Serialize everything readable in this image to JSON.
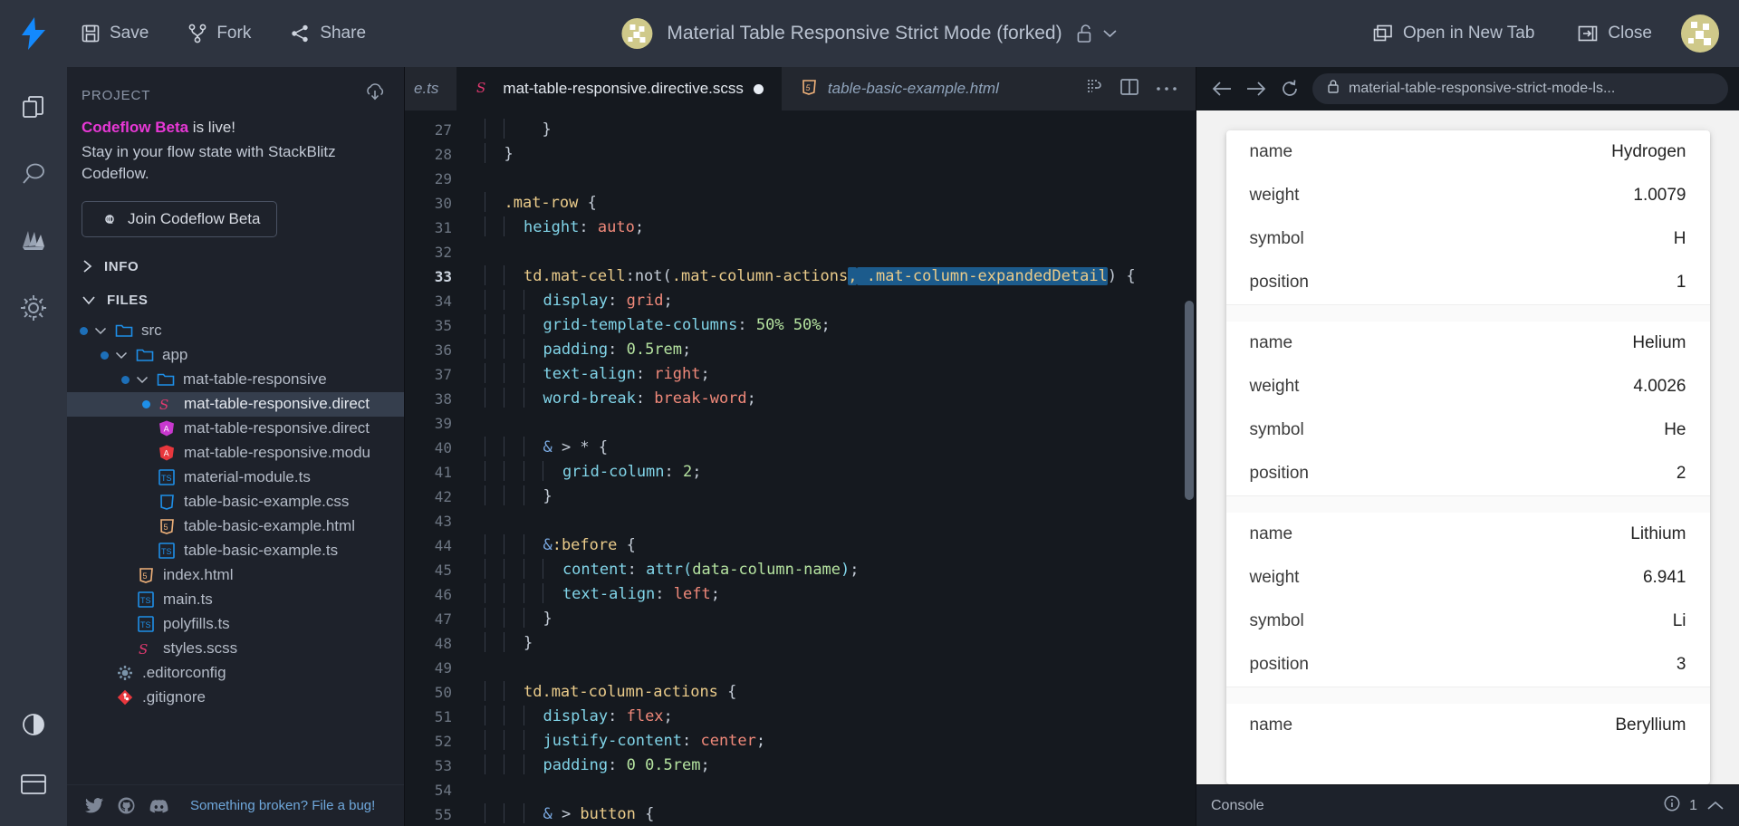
{
  "topbar": {
    "logo": "stackblitz-bolt-icon",
    "save_label": "Save",
    "fork_label": "Fork",
    "share_label": "Share",
    "project_title": "Material Table Responsive Strict Mode (forked)",
    "open_new_tab_label": "Open in New Tab",
    "close_label": "Close"
  },
  "activity_bar": {
    "items": [
      {
        "name": "files-icon"
      },
      {
        "name": "search-icon"
      },
      {
        "name": "deploy-icon"
      },
      {
        "name": "settings-gear-icon"
      }
    ],
    "bottom": [
      {
        "name": "theme-contrast-icon"
      },
      {
        "name": "layout-icon"
      }
    ]
  },
  "sidebar": {
    "header": "PROJECT",
    "download_icon": "cloud-download-icon",
    "promo": {
      "brand": "Codeflow Beta",
      "headline_rest": " is live!",
      "body": "Stay in your flow state with StackBlitz Codeflow.",
      "button": "Join Codeflow Beta"
    },
    "sections": [
      {
        "label": "INFO",
        "expanded": false
      },
      {
        "label": "FILES",
        "expanded": true
      }
    ],
    "files": [
      {
        "label": "src",
        "type": "folder",
        "depth": 0,
        "dot": true,
        "expanded": true
      },
      {
        "label": "app",
        "type": "folder",
        "depth": 1,
        "dot": true,
        "expanded": true
      },
      {
        "label": "mat-table-responsive",
        "type": "folder",
        "depth": 2,
        "dot": true,
        "expanded": true
      },
      {
        "label": "mat-table-responsive.direct",
        "type": "scss",
        "depth": 3,
        "dot": true,
        "selected": true
      },
      {
        "label": "mat-table-responsive.direct",
        "type": "angular-pink",
        "depth": 3,
        "dot": false
      },
      {
        "label": "mat-table-responsive.modu",
        "type": "angular-red",
        "depth": 3,
        "dot": false
      },
      {
        "label": "material-module.ts",
        "type": "ts",
        "depth": 3,
        "dot": false
      },
      {
        "label": "table-basic-example.css",
        "type": "css",
        "depth": 3,
        "dot": false
      },
      {
        "label": "table-basic-example.html",
        "type": "html",
        "depth": 3,
        "dot": false
      },
      {
        "label": "table-basic-example.ts",
        "type": "ts",
        "depth": 3,
        "dot": false
      },
      {
        "label": "index.html",
        "type": "html",
        "depth": 2,
        "dot": false
      },
      {
        "label": "main.ts",
        "type": "ts",
        "depth": 2,
        "dot": false
      },
      {
        "label": "polyfills.ts",
        "type": "ts",
        "depth": 2,
        "dot": false
      },
      {
        "label": "styles.scss",
        "type": "scss",
        "depth": 2,
        "dot": false
      },
      {
        "label": ".editorconfig",
        "type": "config",
        "depth": 1,
        "dot": false
      },
      {
        "label": ".gitignore",
        "type": "git",
        "depth": 1,
        "dot": false
      }
    ],
    "footer": {
      "social": [
        "twitter-icon",
        "github-icon",
        "discord-icon"
      ],
      "bug_label": "Something broken? File a bug!"
    }
  },
  "editor": {
    "tabs": [
      {
        "label": "e.ts",
        "type": "partial",
        "active": false,
        "modified": false
      },
      {
        "label": "mat-table-responsive.directive.scss",
        "type": "scss",
        "active": true,
        "modified": true
      },
      {
        "label": "table-basic-example.html",
        "type": "html",
        "active": false,
        "modified": false
      }
    ],
    "actions": [
      "format-icon",
      "split-editor-icon",
      "more-icon"
    ],
    "first_line_number": 27,
    "current_line": 33,
    "lines": [
      {
        "n": 27,
        "indent": 2,
        "tokens": [
          {
            "t": "  }",
            "c": "punc"
          }
        ]
      },
      {
        "n": 28,
        "indent": 1,
        "tokens": [
          {
            "t": "}",
            "c": "punc"
          }
        ]
      },
      {
        "n": 29,
        "indent": 0,
        "tokens": []
      },
      {
        "n": 30,
        "indent": 1,
        "tokens": [
          {
            "t": ".mat-row",
            "c": "sel"
          },
          {
            "t": " {",
            "c": "punc"
          }
        ]
      },
      {
        "n": 31,
        "indent": 2,
        "tokens": [
          {
            "t": "height",
            "c": "prop"
          },
          {
            "t": ": ",
            "c": "punc"
          },
          {
            "t": "auto",
            "c": "val"
          },
          {
            "t": ";",
            "c": "punc"
          }
        ]
      },
      {
        "n": 32,
        "indent": 0,
        "tokens": []
      },
      {
        "n": 33,
        "indent": 2,
        "tokens": [
          {
            "t": "td",
            "c": "sel"
          },
          {
            "t": ".mat-cell",
            "c": "sel"
          },
          {
            "t": ":not(",
            "c": "punc"
          },
          {
            "t": ".mat-column-actions",
            "c": "sel"
          },
          {
            "t": ",",
            "c": "hl"
          },
          {
            "t": " .mat-column-expandedDetail",
            "c": "hl"
          },
          {
            "t": ")",
            "c": "punc"
          },
          {
            "t": " {",
            "c": "punc"
          }
        ]
      },
      {
        "n": 34,
        "indent": 3,
        "tokens": [
          {
            "t": "display",
            "c": "prop"
          },
          {
            "t": ": ",
            "c": "punc"
          },
          {
            "t": "grid",
            "c": "val"
          },
          {
            "t": ";",
            "c": "punc"
          }
        ]
      },
      {
        "n": 35,
        "indent": 3,
        "tokens": [
          {
            "t": "grid-template-columns",
            "c": "prop"
          },
          {
            "t": ": ",
            "c": "punc"
          },
          {
            "t": "50% 50%",
            "c": "num"
          },
          {
            "t": ";",
            "c": "punc"
          }
        ]
      },
      {
        "n": 36,
        "indent": 3,
        "tokens": [
          {
            "t": "padding",
            "c": "prop"
          },
          {
            "t": ": ",
            "c": "punc"
          },
          {
            "t": "0.5rem",
            "c": "num"
          },
          {
            "t": ";",
            "c": "punc"
          }
        ]
      },
      {
        "n": 37,
        "indent": 3,
        "tokens": [
          {
            "t": "text-align",
            "c": "prop"
          },
          {
            "t": ": ",
            "c": "punc"
          },
          {
            "t": "right",
            "c": "val"
          },
          {
            "t": ";",
            "c": "punc"
          }
        ]
      },
      {
        "n": 38,
        "indent": 3,
        "tokens": [
          {
            "t": "word-break",
            "c": "prop"
          },
          {
            "t": ": ",
            "c": "punc"
          },
          {
            "t": "break-word",
            "c": "val"
          },
          {
            "t": ";",
            "c": "punc"
          }
        ]
      },
      {
        "n": 39,
        "indent": 0,
        "tokens": []
      },
      {
        "n": 40,
        "indent": 3,
        "tokens": [
          {
            "t": "&",
            "c": "amp"
          },
          {
            "t": " > * {",
            "c": "punc"
          }
        ]
      },
      {
        "n": 41,
        "indent": 4,
        "tokens": [
          {
            "t": "grid-column",
            "c": "prop"
          },
          {
            "t": ": ",
            "c": "punc"
          },
          {
            "t": "2",
            "c": "num"
          },
          {
            "t": ";",
            "c": "punc"
          }
        ]
      },
      {
        "n": 42,
        "indent": 3,
        "tokens": [
          {
            "t": "}",
            "c": "punc"
          }
        ]
      },
      {
        "n": 43,
        "indent": 0,
        "tokens": []
      },
      {
        "n": 44,
        "indent": 3,
        "tokens": [
          {
            "t": "&",
            "c": "amp"
          },
          {
            "t": ":before",
            "c": "sel"
          },
          {
            "t": " {",
            "c": "punc"
          }
        ]
      },
      {
        "n": 45,
        "indent": 4,
        "tokens": [
          {
            "t": "content",
            "c": "prop"
          },
          {
            "t": ": ",
            "c": "punc"
          },
          {
            "t": "attr(",
            "c": "fn"
          },
          {
            "t": "data-column-name",
            "c": "num"
          },
          {
            "t": ")",
            "c": "fn"
          },
          {
            "t": ";",
            "c": "punc"
          }
        ]
      },
      {
        "n": 46,
        "indent": 4,
        "tokens": [
          {
            "t": "text-align",
            "c": "prop"
          },
          {
            "t": ": ",
            "c": "punc"
          },
          {
            "t": "left",
            "c": "val"
          },
          {
            "t": ";",
            "c": "punc"
          }
        ]
      },
      {
        "n": 47,
        "indent": 3,
        "tokens": [
          {
            "t": "}",
            "c": "punc"
          }
        ]
      },
      {
        "n": 48,
        "indent": 2,
        "tokens": [
          {
            "t": "}",
            "c": "punc"
          }
        ]
      },
      {
        "n": 49,
        "indent": 0,
        "tokens": []
      },
      {
        "n": 50,
        "indent": 2,
        "tokens": [
          {
            "t": "td",
            "c": "sel"
          },
          {
            "t": ".mat-column-actions",
            "c": "sel"
          },
          {
            "t": " {",
            "c": "punc"
          }
        ]
      },
      {
        "n": 51,
        "indent": 3,
        "tokens": [
          {
            "t": "display",
            "c": "prop"
          },
          {
            "t": ": ",
            "c": "punc"
          },
          {
            "t": "flex",
            "c": "val"
          },
          {
            "t": ";",
            "c": "punc"
          }
        ]
      },
      {
        "n": 52,
        "indent": 3,
        "tokens": [
          {
            "t": "justify-content",
            "c": "prop"
          },
          {
            "t": ": ",
            "c": "punc"
          },
          {
            "t": "center",
            "c": "val"
          },
          {
            "t": ";",
            "c": "punc"
          }
        ]
      },
      {
        "n": 53,
        "indent": 3,
        "tokens": [
          {
            "t": "padding",
            "c": "prop"
          },
          {
            "t": ": ",
            "c": "punc"
          },
          {
            "t": "0 0.5rem",
            "c": "num"
          },
          {
            "t": ";",
            "c": "punc"
          }
        ]
      },
      {
        "n": 54,
        "indent": 0,
        "tokens": []
      },
      {
        "n": 55,
        "indent": 3,
        "tokens": [
          {
            "t": "&",
            "c": "amp"
          },
          {
            "t": " > ",
            "c": "punc"
          },
          {
            "t": "button",
            "c": "sel"
          },
          {
            "t": " {",
            "c": "punc"
          }
        ]
      }
    ]
  },
  "preview": {
    "toolbar": {
      "back_icon": "arrow-left-icon",
      "forward_icon": "arrow-right-icon",
      "reload_icon": "reload-icon",
      "lock_icon": "lock-icon",
      "url": "material-table-responsive-strict-mode-ls..."
    },
    "table_groups": [
      {
        "rows": [
          {
            "key": "name",
            "value": "Hydrogen"
          },
          {
            "key": "weight",
            "value": "1.0079"
          },
          {
            "key": "symbol",
            "value": "H"
          },
          {
            "key": "position",
            "value": "1"
          }
        ]
      },
      {
        "rows": [
          {
            "key": "name",
            "value": "Helium"
          },
          {
            "key": "weight",
            "value": "4.0026"
          },
          {
            "key": "symbol",
            "value": "He"
          },
          {
            "key": "position",
            "value": "2"
          }
        ]
      },
      {
        "rows": [
          {
            "key": "name",
            "value": "Lithium"
          },
          {
            "key": "weight",
            "value": "6.941"
          },
          {
            "key": "symbol",
            "value": "Li"
          },
          {
            "key": "position",
            "value": "3"
          }
        ]
      },
      {
        "rows": [
          {
            "key": "name",
            "value": "Beryllium"
          }
        ]
      }
    ],
    "console": {
      "label": "Console",
      "info_icon": "info-icon",
      "count": "1",
      "expand_icon": "chevron-up-icon"
    }
  },
  "colors": {
    "accent_blue": "#1e8fe8",
    "brand_pink": "#e838d6",
    "topbar_bg": "#2e3440",
    "sidebar_bg": "#1e222b",
    "editor_bg": "#15191f"
  }
}
